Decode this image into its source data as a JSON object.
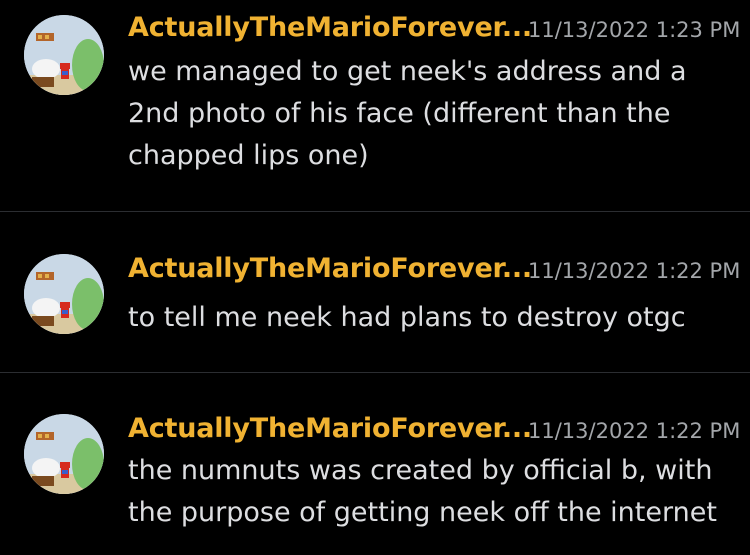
{
  "colors": {
    "background": "#000000",
    "username": "#f0b232",
    "timestamp": "#a3a6aa",
    "message_text": "#dddee1",
    "divider": "#2b2d31"
  },
  "messages": [
    {
      "avatar_icon": "mario-avatar-icon",
      "username": "ActuallyTheMarioForever...",
      "timestamp": "11/13/2022 1:23 PM",
      "lines": [
        "we managed to get neek's address and a",
        "2nd photo of his face (different than the",
        "chapped lips one)"
      ]
    },
    {
      "avatar_icon": "mario-avatar-icon",
      "username": "ActuallyTheMarioForever...",
      "timestamp": "11/13/2022 1:22 PM",
      "lines": [
        "to tell me neek had plans to destroy otgc"
      ]
    },
    {
      "avatar_icon": "mario-avatar-icon",
      "username": "ActuallyTheMarioForever...",
      "timestamp": "11/13/2022 1:22 PM",
      "lines": [
        "the numnuts was created by official b, with",
        "the purpose of getting neek off the internet"
      ]
    }
  ]
}
